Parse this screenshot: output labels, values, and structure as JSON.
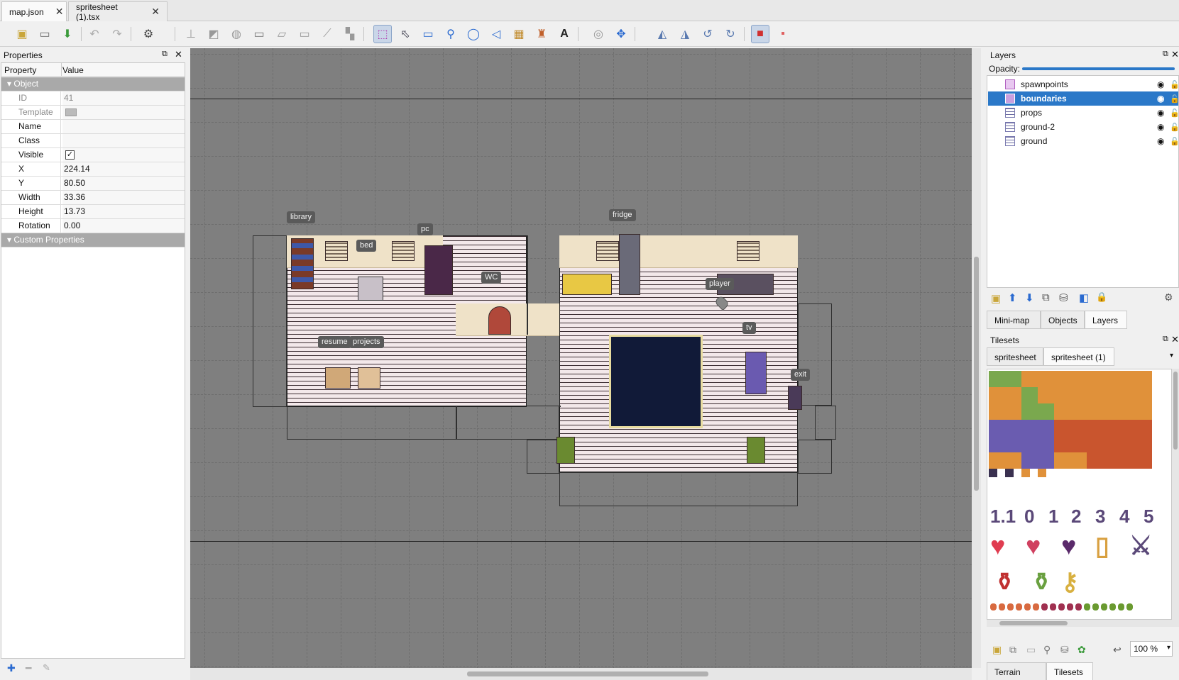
{
  "tabs": [
    {
      "label": "map.json",
      "active": true
    },
    {
      "label": "spritesheet (1).tsx",
      "active": false
    }
  ],
  "toolbar": {
    "icons": [
      "new-map-icon",
      "open-icon",
      "save-icon",
      "undo-icon",
      "redo-icon",
      "stamp-brush-icon",
      "terrain-brush-icon",
      "bucket-fill-icon",
      "shape-fill-icon",
      "eraser-icon",
      "rectangular-select-icon",
      "magic-wand-icon",
      "select-same-tile-icon",
      "select-objects-icon",
      "edit-polygons-icon",
      "insert-rectangle-icon",
      "insert-point-icon",
      "insert-ellipse-icon",
      "insert-polygon-icon",
      "insert-tile-icon",
      "insert-template-icon",
      "insert-text-icon",
      "world-tool-icon",
      "random-mode-icon",
      "flip-horizontal-icon",
      "flip-vertical-icon",
      "rotate-left-icon",
      "rotate-right-icon",
      "highlight-layer-icon",
      "show-tile-collision-icon"
    ]
  },
  "properties": {
    "title": "Properties",
    "col_property": "Property",
    "col_value": "Value",
    "group_object": "Object",
    "rows": [
      {
        "key": "ID",
        "value": "41",
        "disabled": true
      },
      {
        "key": "Template",
        "value": "",
        "disabled": true
      },
      {
        "key": "Name",
        "value": ""
      },
      {
        "key": "Class",
        "value": ""
      },
      {
        "key": "Visible",
        "value": "✓"
      },
      {
        "key": "X",
        "value": "224.14"
      },
      {
        "key": "Y",
        "value": "80.50"
      },
      {
        "key": "Width",
        "value": "33.36"
      },
      {
        "key": "Height",
        "value": "13.73"
      },
      {
        "key": "Rotation",
        "value": "0.00"
      }
    ],
    "group_custom": "Custom Properties"
  },
  "map": {
    "labels": [
      "library",
      "bed",
      "pc",
      "WC",
      "fridge",
      "player",
      "resume",
      "projects",
      "tv",
      "exit"
    ]
  },
  "layers": {
    "title": "Layers",
    "opacity_label": "Opacity:",
    "opacity": 0.98,
    "items": [
      {
        "name": "spawnpoints",
        "type": "object",
        "selected": false
      },
      {
        "name": "boundaries",
        "type": "object",
        "selected": true
      },
      {
        "name": "props",
        "type": "tile",
        "selected": false
      },
      {
        "name": "ground-2",
        "type": "tile",
        "selected": false
      },
      {
        "name": "ground",
        "type": "tile",
        "selected": false
      }
    ],
    "bottom_tabs": [
      "Mini-map",
      "Objects",
      "Layers"
    ]
  },
  "tilesets": {
    "title": "Tilesets",
    "tabs": [
      "spritesheet",
      "spritesheet (1)"
    ],
    "glyphs": [
      "1.1",
      "0",
      "1",
      "2",
      "3",
      "4",
      "5"
    ],
    "zoom": "100 %",
    "bottom_tabs": [
      "Terrain Sets",
      "Tilesets"
    ],
    "colors": {
      "grass": "#7aa84e",
      "sand": "#e0913a",
      "water": "#6a5cb0",
      "lava": "#c9552e",
      "dark": "#3a3150",
      "heart": "#e03c50"
    }
  }
}
